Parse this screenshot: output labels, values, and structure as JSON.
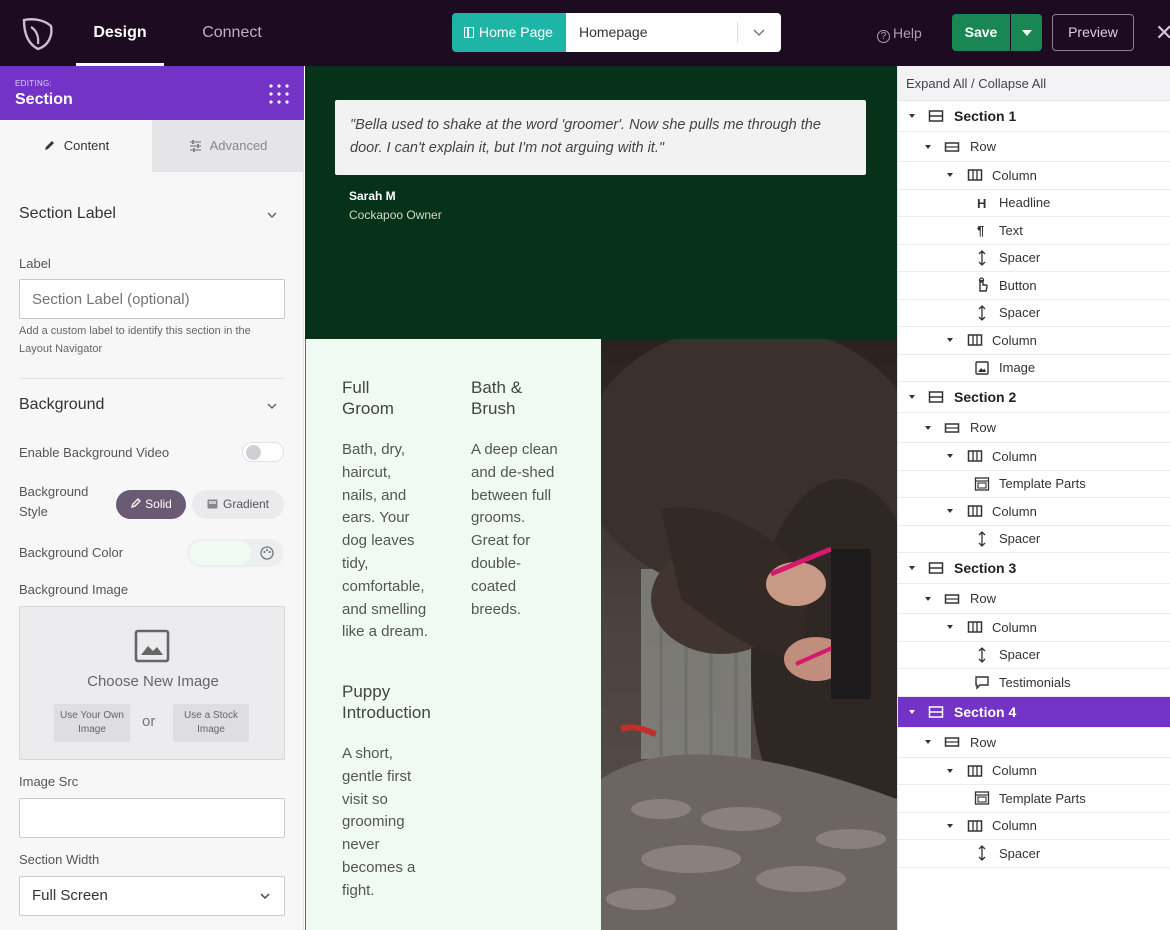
{
  "topbar": {
    "tabs": [
      "Design",
      "Connect"
    ],
    "page_type": "Home Page",
    "page_select": "Homepage",
    "help": "Help",
    "save": "Save",
    "preview": "Preview"
  },
  "panel": {
    "editing_label": "EDITING:",
    "editing_title": "Section",
    "tab_content": "Content",
    "tab_advanced": "Advanced",
    "section_label_heading": "Section Label",
    "label_field": "Label",
    "label_placeholder": "Section Label (optional)",
    "label_help": "Add a custom label to identify this section in the Layout Navigator",
    "background_heading": "Background",
    "enable_video": "Enable Background Video",
    "background_style": "Background Style",
    "solid": "Solid",
    "gradient": "Gradient",
    "background_color": "Background Color",
    "background_color_value": "#eefaf2",
    "background_image": "Background Image",
    "choose_image": "Choose New Image",
    "own_image": "Use Your Own Image",
    "or": "or",
    "stock_image": "Use a Stock Image",
    "image_src": "Image Src",
    "section_width": "Section Width",
    "section_width_value": "Full Screen"
  },
  "canvas": {
    "quote": "\"Bella used to shake at the word 'groomer'. Now she pulls me through the door. I can't explain it, but I'm not arguing with it.\"",
    "author": "Sarah M",
    "author_role": "Cockapoo Owner",
    "services": [
      {
        "title_lines": [
          "Full",
          "Groom"
        ],
        "body_lines": [
          "Bath, dry,",
          "haircut,",
          "nails, and",
          "ears. Your",
          "dog leaves",
          "tidy,",
          "comfortable,",
          "and smelling",
          "like a dream."
        ]
      },
      {
        "title_lines": [
          "Bath &",
          "Brush"
        ],
        "body_lines": [
          "A deep clean",
          "and de-shed",
          "between full",
          "grooms.",
          "Great for",
          "double-",
          "coated",
          "breeds."
        ]
      },
      {
        "title_lines": [
          "Puppy",
          "Introduction"
        ],
        "body_lines": [
          "A short,",
          "gentle first",
          "visit so",
          "grooming",
          "never",
          "becomes a",
          "fight."
        ]
      }
    ]
  },
  "navigator": {
    "expand_collapse": "Expand All / Collapse All",
    "items": [
      {
        "label": "Section 1",
        "level": 0,
        "icon": "section-icon",
        "caret": true
      },
      {
        "label": "Row",
        "level": 1,
        "icon": "row-icon",
        "caret": true
      },
      {
        "label": "Column",
        "level": 2,
        "icon": "column-icon",
        "caret": true
      },
      {
        "label": "Headline",
        "level": 3,
        "icon": "headline-icon",
        "caret": false
      },
      {
        "label": "Text",
        "level": 3,
        "icon": "text-icon",
        "caret": false
      },
      {
        "label": "Spacer",
        "level": 3,
        "icon": "spacer-icon",
        "caret": false
      },
      {
        "label": "Button",
        "level": 3,
        "icon": "button-icon",
        "caret": false
      },
      {
        "label": "Spacer",
        "level": 3,
        "icon": "spacer-icon",
        "caret": false
      },
      {
        "label": "Column",
        "level": 2,
        "icon": "column-icon",
        "caret": true
      },
      {
        "label": "Image",
        "level": 3,
        "icon": "image-icon",
        "caret": false
      },
      {
        "label": "Section 2",
        "level": 0,
        "icon": "section-icon",
        "caret": true
      },
      {
        "label": "Row",
        "level": 1,
        "icon": "row-icon",
        "caret": true
      },
      {
        "label": "Column",
        "level": 2,
        "icon": "column-icon",
        "caret": true
      },
      {
        "label": "Template Parts",
        "level": 3,
        "icon": "template-parts-icon",
        "caret": false
      },
      {
        "label": "Column",
        "level": 2,
        "icon": "column-icon",
        "caret": true
      },
      {
        "label": "Spacer",
        "level": 3,
        "icon": "spacer-icon",
        "caret": false
      },
      {
        "label": "Section 3",
        "level": 0,
        "icon": "section-icon",
        "caret": true
      },
      {
        "label": "Row",
        "level": 1,
        "icon": "row-icon",
        "caret": true
      },
      {
        "label": "Column",
        "level": 2,
        "icon": "column-icon",
        "caret": true
      },
      {
        "label": "Spacer",
        "level": 3,
        "icon": "spacer-icon",
        "caret": false
      },
      {
        "label": "Testimonials",
        "level": 3,
        "icon": "testimonials-icon",
        "caret": false
      },
      {
        "label": "Section 4",
        "level": 0,
        "icon": "section-icon",
        "caret": true,
        "active": true
      },
      {
        "label": "Row",
        "level": 1,
        "icon": "row-icon",
        "caret": true
      },
      {
        "label": "Column",
        "level": 2,
        "icon": "column-icon",
        "caret": true
      },
      {
        "label": "Template Parts",
        "level": 3,
        "icon": "template-parts-icon",
        "caret": false
      },
      {
        "label": "Column",
        "level": 2,
        "icon": "column-icon",
        "caret": true
      },
      {
        "label": "Spacer",
        "level": 3,
        "icon": "spacer-icon",
        "caret": false
      }
    ]
  },
  "colors": {
    "topbar": "#1d0b22",
    "accent_purple": "#7433c7",
    "teal": "#1fb5a6",
    "save_green": "#198754",
    "testimonial_bg": "#06321a",
    "services_bg": "#eefaf2"
  }
}
